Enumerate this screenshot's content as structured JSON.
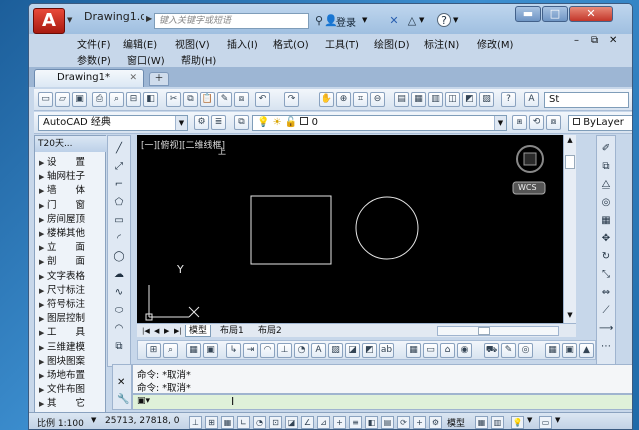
{
  "window": {
    "doc_title": "Drawing1.d...",
    "search_placeholder": "键入关键字或短语",
    "login_label": "登录"
  },
  "menus": {
    "row1": [
      "文件(F)",
      "编辑(E)",
      "视图(V)",
      "插入(I)",
      "格式(O)",
      "工具(T)",
      "绘图(D)",
      "标注(N)",
      "修改(M)"
    ],
    "row2": [
      "参数(P)",
      "窗口(W)",
      "帮助(H)"
    ]
  },
  "tabs": {
    "document_tab": "Drawing1*"
  },
  "toolbar2": {
    "workspace": "AutoCAD 经典",
    "layer": "0",
    "bylayer": "ByLayer"
  },
  "toolbar1": {
    "text_style_partial": "St"
  },
  "tpanel": {
    "title": "T20天...",
    "items": [
      "设　　置",
      "轴网柱子",
      "墙　　体",
      "门　　窗",
      "房间屋顶",
      "楼梯其他",
      "立　　面",
      "剖　　面",
      "文字表格",
      "尺寸标注",
      "符号标注",
      "图层控制",
      "工　　具",
      "三维建模",
      "图块图案",
      "场地布置",
      "文件布图",
      "其　　它"
    ]
  },
  "canvas": {
    "viewport_label": "[一][俯视][二维线框]",
    "viewcube_label": "上",
    "wcs_label": "WCS",
    "axis_x": "X",
    "axis_y": "Y"
  },
  "layout_tabs": [
    "模型",
    "布局1",
    "布局2"
  ],
  "command": {
    "lines": [
      "命令: *取消*",
      "命令: *取消*"
    ]
  },
  "status": {
    "scale": "比例 1:100",
    "coords": "25713, 27818, 0",
    "model": "模型"
  },
  "colors": {
    "canvas_bg": "#000000",
    "title_bg": "#9fbfe0",
    "cmd_input_bg": "#dff1d9"
  }
}
